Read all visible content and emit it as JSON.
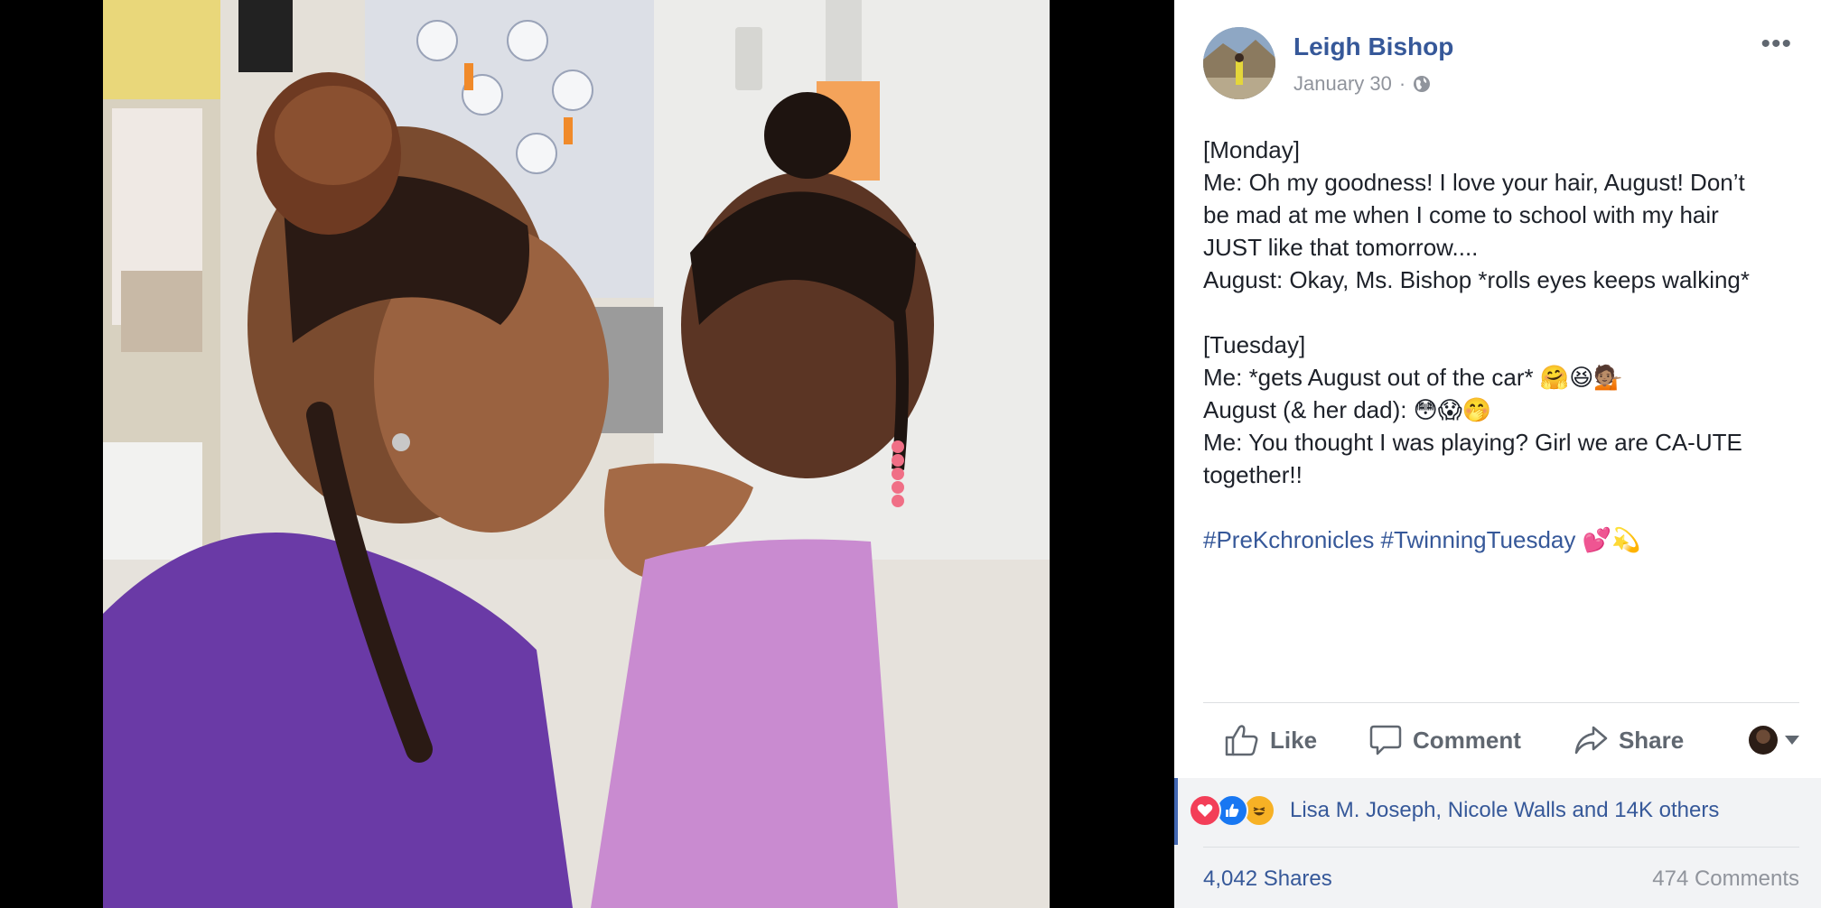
{
  "post": {
    "author": "Leigh Bishop",
    "date": "January 30",
    "date_separator": "·",
    "privacy_icon": "globe-icon",
    "more_label": "•••",
    "lines": [
      "[Monday]",
      "Me: Oh my goodness! I love your hair, August! Don’t",
      "be mad at me when I come to school with my hair",
      "JUST like that tomorrow....",
      "August: Okay, Ms. Bishop *rolls eyes keeps walking*",
      "",
      "[Tuesday]",
      "Me: *gets August out of the car* 🤗😆💁🏽",
      "August (& her dad): 😳😱🤭",
      "Me: You thought I was playing? Girl we are CA-UTE",
      "together!!"
    ],
    "hashtag_1": "#PreKchronicles",
    "hashtag_2": "#TwinningTuesday",
    "hashtag_emoji": "💕💫"
  },
  "actions": {
    "like": "Like",
    "comment": "Comment",
    "share": "Share"
  },
  "reactions": {
    "types": [
      "love",
      "like",
      "haha"
    ],
    "summary": "Lisa M. Joseph, Nicole Walls and 14K others"
  },
  "stats": {
    "shares": "4,042 Shares",
    "comments": "474 Comments"
  },
  "colors": {
    "link": "#365899",
    "secondary_text": "#90949c",
    "love": "#f33e58",
    "like": "#1877f2",
    "haha": "#f7b125"
  }
}
